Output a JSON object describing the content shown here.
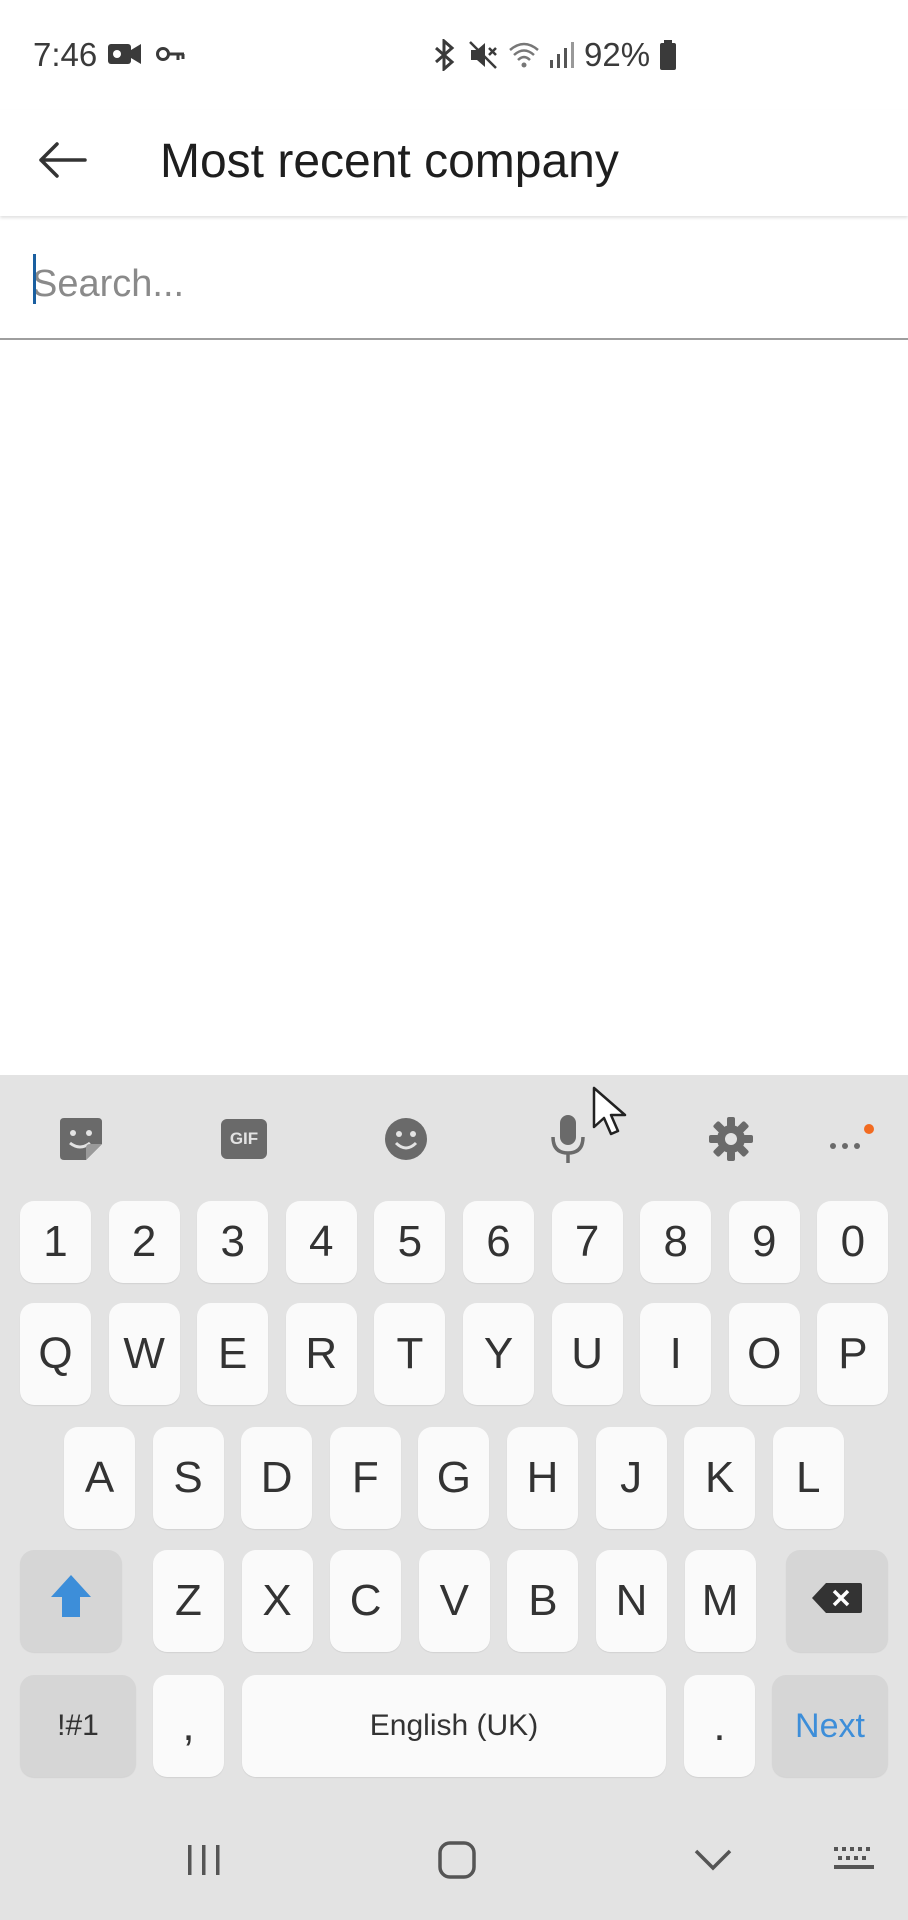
{
  "status_bar": {
    "time": "7:46",
    "battery": "92%",
    "left_icons": [
      "video-camera-icon",
      "key-icon"
    ],
    "right_icons": [
      "bluetooth-icon",
      "mute-icon",
      "wifi-icon",
      "signal-icon",
      "battery-icon"
    ]
  },
  "app_bar": {
    "back_icon": "arrow-left-icon",
    "title": "Most recent company"
  },
  "search": {
    "placeholder": "Search...",
    "value": ""
  },
  "keyboard": {
    "toolbar": [
      "sticker-icon",
      "gif-icon",
      "emoji-icon",
      "microphone-icon",
      "settings-icon",
      "more-icon"
    ],
    "toolbar_gif_label": "GIF",
    "number_row": [
      "1",
      "2",
      "3",
      "4",
      "5",
      "6",
      "7",
      "8",
      "9",
      "0"
    ],
    "row1": [
      "Q",
      "W",
      "E",
      "R",
      "T",
      "Y",
      "U",
      "I",
      "O",
      "P"
    ],
    "row2": [
      "A",
      "S",
      "D",
      "F",
      "G",
      "H",
      "J",
      "K",
      "L"
    ],
    "row3": [
      "Z",
      "X",
      "C",
      "V",
      "B",
      "N",
      "M"
    ],
    "symbols_label": "!#1",
    "comma_label": ",",
    "space_label": "English (UK)",
    "period_label": ".",
    "action_label": "Next",
    "accent_color": "#3d8ed9"
  },
  "nav_bar": [
    "recents-icon",
    "home-icon",
    "hide-keyboard-icon",
    "keyboard-switch-icon"
  ]
}
